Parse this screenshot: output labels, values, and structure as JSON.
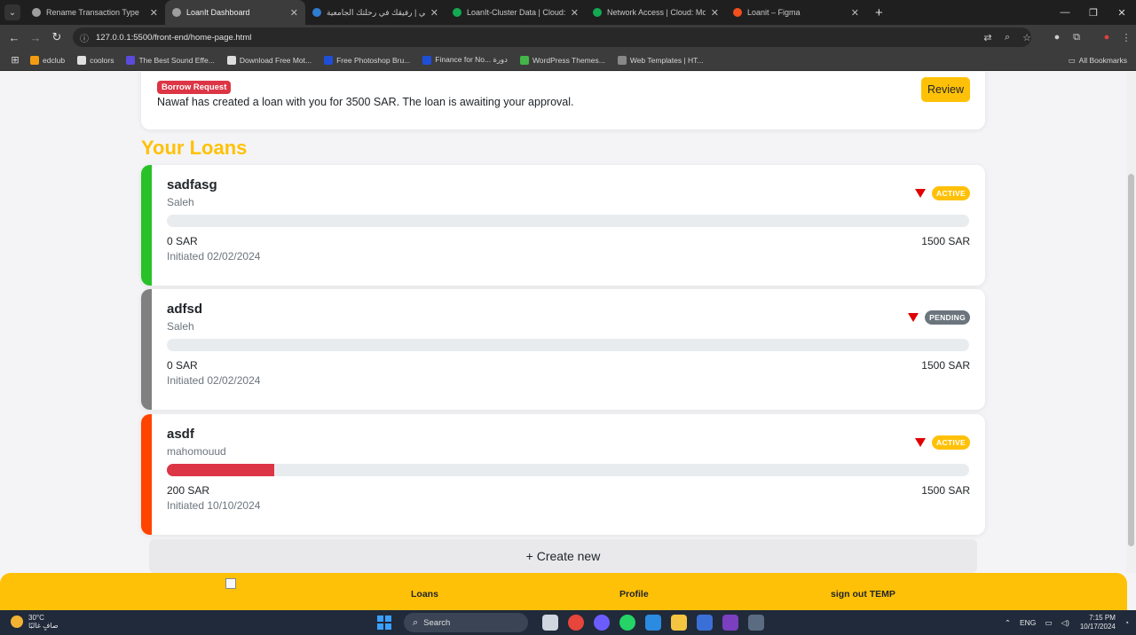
{
  "browser": {
    "tabs": [
      {
        "title": "Rename Transaction Type",
        "active": false,
        "color": "#9e9e9e"
      },
      {
        "title": "LoanIt Dashboard",
        "active": true,
        "color": "#9e9e9e"
      },
      {
        "title": "مقرراتي | رفيقك في رحلتك الجامعية",
        "active": false,
        "color": "#2f7dd1"
      },
      {
        "title": "LoanIt-Cluster Data | Cloud: Mo",
        "active": false,
        "color": "#13aa52"
      },
      {
        "title": "Network Access | Cloud: Mongo",
        "active": false,
        "color": "#13aa52"
      },
      {
        "title": "Loanit – Figma",
        "active": false,
        "color": "#f24e1e"
      }
    ],
    "url": "127.0.0.1:5500/front-end/home-page.html",
    "bookmarks": [
      {
        "label": "edclub",
        "color": "#f39c12"
      },
      {
        "label": "coolors",
        "color": "#e0e0e0"
      },
      {
        "label": "The Best Sound Effe...",
        "color": "#5b4bdb"
      },
      {
        "label": "Download Free Mot...",
        "color": "#dddddd"
      },
      {
        "label": "Free Photoshop Bru...",
        "color": "#1e4fd6"
      },
      {
        "label": "Finance for No... دورة",
        "color": "#1e4fd6"
      },
      {
        "label": "WordPress Themes...",
        "color": "#44b54a"
      },
      {
        "label": "Web Templates | HT...",
        "color": "#888888"
      }
    ],
    "all_bookmarks": "All Bookmarks"
  },
  "notification": {
    "badge": "Borrow Request",
    "message": "Nawaf has created a loan with you for 3500 SAR. The loan is awaiting your approval.",
    "review_label": "Review"
  },
  "section_title": "Your Loans",
  "loans": [
    {
      "name": "sadfasg",
      "person": "Saleh",
      "paid": "0 SAR",
      "total": "1500 SAR",
      "initiated": "Initiated 02/02/2024",
      "status": "ACTIVE",
      "status_color": "#ffc107",
      "stripe_color": "#28c228",
      "progress": 0
    },
    {
      "name": "adfsd",
      "person": "Saleh",
      "paid": "0 SAR",
      "total": "1500 SAR",
      "initiated": "Initiated 02/02/2024",
      "status": "PENDING",
      "status_color": "#6c757d",
      "stripe_color": "#808080",
      "progress": 0
    },
    {
      "name": "asdf",
      "person": "mahomouud",
      "paid": "200 SAR",
      "total": "1500 SAR",
      "initiated": "Initiated 10/10/2024",
      "status": "ACTIVE",
      "status_color": "#ffc107",
      "stripe_color": "#ff4400",
      "progress": 0.1333
    }
  ],
  "create_new_label": "+ Create new",
  "bottom_nav": {
    "links": [
      "Loans",
      "Profile",
      "sign out TEMP"
    ]
  },
  "taskbar": {
    "temp": "30°C",
    "weather_text": "صافٍ غالبًا",
    "search": "Search",
    "lang": "ENG",
    "time": "7:15 PM",
    "date": "10/17/2024"
  }
}
